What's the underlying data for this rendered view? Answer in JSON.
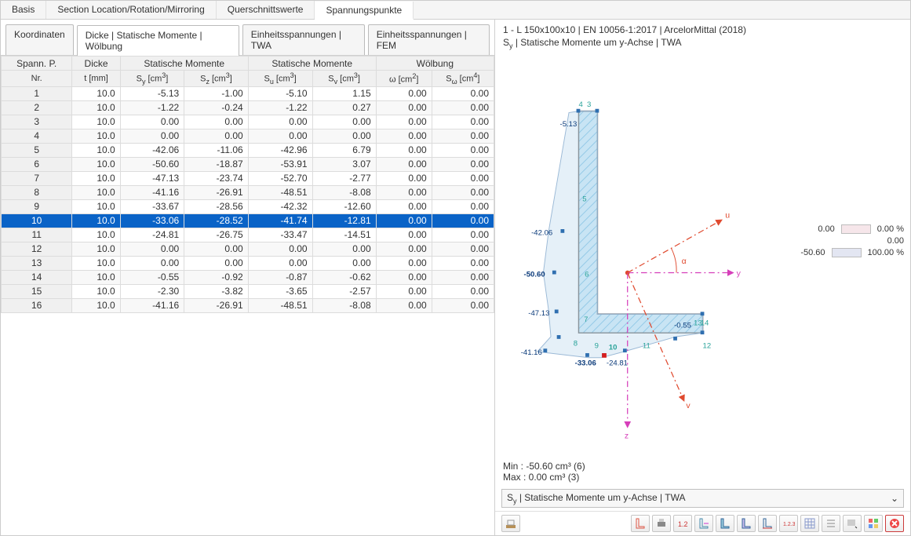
{
  "toptabs": {
    "items": [
      "Basis",
      "Section Location/Rotation/Mirroring",
      "Querschnittswerte",
      "Spannungspunkte"
    ],
    "active": 3
  },
  "subtabs": {
    "items": [
      "Koordinaten",
      "Dicke | Statische Momente | Wölbung",
      "Einheitsspannungen | TWA",
      "Einheitsspannungen | FEM"
    ],
    "active": 1
  },
  "table": {
    "group_headers": {
      "nr": "Spann. P.",
      "dicke": "Dicke",
      "stat1": "Statische Momente",
      "stat2": "Statische Momente",
      "wolb": "Wölbung"
    },
    "unit_headers": {
      "nr": "Nr.",
      "t": "t [mm]",
      "sy": "Sy [cm³]",
      "sz": "Sz [cm³]",
      "su": "Su [cm³]",
      "sv": "Sv [cm³]",
      "om": "ω [cm²]",
      "sw": "Sω [cm⁴]"
    },
    "rows": [
      {
        "n": "1",
        "t": "10.0",
        "sy": "-5.13",
        "sz": "-1.00",
        "su": "-5.10",
        "sv": "1.15",
        "om": "0.00",
        "sw": "0.00"
      },
      {
        "n": "2",
        "t": "10.0",
        "sy": "-1.22",
        "sz": "-0.24",
        "su": "-1.22",
        "sv": "0.27",
        "om": "0.00",
        "sw": "0.00"
      },
      {
        "n": "3",
        "t": "10.0",
        "sy": "0.00",
        "sz": "0.00",
        "su": "0.00",
        "sv": "0.00",
        "om": "0.00",
        "sw": "0.00"
      },
      {
        "n": "4",
        "t": "10.0",
        "sy": "0.00",
        "sz": "0.00",
        "su": "0.00",
        "sv": "0.00",
        "om": "0.00",
        "sw": "0.00"
      },
      {
        "n": "5",
        "t": "10.0",
        "sy": "-42.06",
        "sz": "-11.06",
        "su": "-42.96",
        "sv": "6.79",
        "om": "0.00",
        "sw": "0.00"
      },
      {
        "n": "6",
        "t": "10.0",
        "sy": "-50.60",
        "sz": "-18.87",
        "su": "-53.91",
        "sv": "3.07",
        "om": "0.00",
        "sw": "0.00"
      },
      {
        "n": "7",
        "t": "10.0",
        "sy": "-47.13",
        "sz": "-23.74",
        "su": "-52.70",
        "sv": "-2.77",
        "om": "0.00",
        "sw": "0.00"
      },
      {
        "n": "8",
        "t": "10.0",
        "sy": "-41.16",
        "sz": "-26.91",
        "su": "-48.51",
        "sv": "-8.08",
        "om": "0.00",
        "sw": "0.00"
      },
      {
        "n": "9",
        "t": "10.0",
        "sy": "-33.67",
        "sz": "-28.56",
        "su": "-42.32",
        "sv": "-12.60",
        "om": "0.00",
        "sw": "0.00"
      },
      {
        "n": "10",
        "t": "10.0",
        "sy": "-33.06",
        "sz": "-28.52",
        "su": "-41.74",
        "sv": "-12.81",
        "om": "0.00",
        "sw": "0.00",
        "selected": true
      },
      {
        "n": "11",
        "t": "10.0",
        "sy": "-24.81",
        "sz": "-26.75",
        "su": "-33.47",
        "sv": "-14.51",
        "om": "0.00",
        "sw": "0.00"
      },
      {
        "n": "12",
        "t": "10.0",
        "sy": "0.00",
        "sz": "0.00",
        "su": "0.00",
        "sv": "0.00",
        "om": "0.00",
        "sw": "0.00"
      },
      {
        "n": "13",
        "t": "10.0",
        "sy": "0.00",
        "sz": "0.00",
        "su": "0.00",
        "sv": "0.00",
        "om": "0.00",
        "sw": "0.00"
      },
      {
        "n": "14",
        "t": "10.0",
        "sy": "-0.55",
        "sz": "-0.92",
        "su": "-0.87",
        "sv": "-0.62",
        "om": "0.00",
        "sw": "0.00"
      },
      {
        "n": "15",
        "t": "10.0",
        "sy": "-2.30",
        "sz": "-3.82",
        "su": "-3.65",
        "sv": "-2.57",
        "om": "0.00",
        "sw": "0.00"
      },
      {
        "n": "16",
        "t": "10.0",
        "sy": "-41.16",
        "sz": "-26.91",
        "su": "-48.51",
        "sv": "-8.08",
        "om": "0.00",
        "sw": "0.00"
      }
    ]
  },
  "right": {
    "title1": "1 - L 150x100x10 | EN 10056-1:2017 | ArcelorMittal (2018)",
    "title2": "Sy | Statische Momente um y-Achse | TWA",
    "min": "Min : -50.60 cm³ (6)",
    "max": "Max :   0.00 cm³ (3)",
    "combo": "Sy | Statische Momente um y-Achse | TWA",
    "legend": [
      {
        "val": "0.00",
        "pct": "0.00 %",
        "color": "#f6e6ea"
      },
      {
        "val": "0.00",
        "pct": "",
        "color": ""
      },
      {
        "val": "-50.60",
        "pct": "100.00 %",
        "color": "#e3e6f2"
      }
    ],
    "ptlabels": {
      "p5_13": "-5.13",
      "p42_06": "-42.06",
      "p50_60": "-50.60",
      "p47_13": "-47.13",
      "p41_16": "-41.16",
      "p33_06": "-33.06",
      "p24_81": "-24.81",
      "p0_55": "-0.55"
    },
    "axes": {
      "u": "u",
      "v": "v",
      "y": "y",
      "z": "z",
      "alpha": "α"
    }
  },
  "toolbar_icons": [
    "lock-icon",
    "section-icon",
    "print-icon",
    "values-icon",
    "axes-icon",
    "stress1-icon",
    "stress2-icon",
    "stress3-icon",
    "dimension-icon",
    "grid-icon",
    "list-icon",
    "dropdown-icon",
    "color-icon",
    "close-icon"
  ]
}
